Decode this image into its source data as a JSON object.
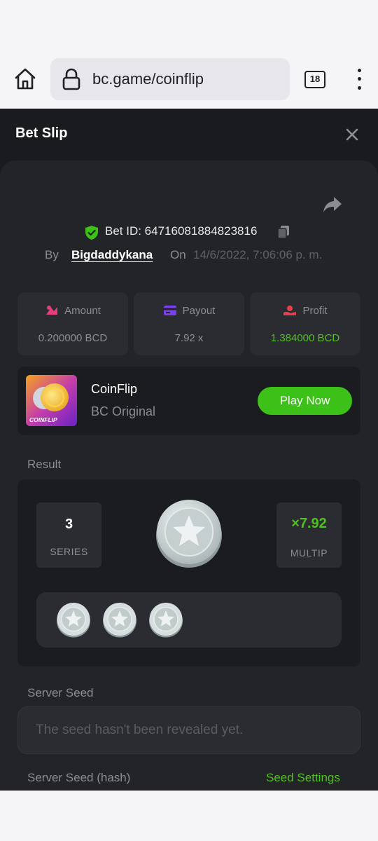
{
  "browser": {
    "url": "bc.game/coinflip",
    "tab_count": "18"
  },
  "header": {
    "title": "Bet Slip"
  },
  "bet": {
    "id_label": "Bet ID: 64716081884823816",
    "by_label": "By",
    "user": "Bigdaddykana",
    "on_label": "On",
    "date": "14/6/2022, 7:06:06 p. m."
  },
  "stats": [
    {
      "label": "Amount",
      "value": "0.200000 BCD",
      "icon": "amount-icon",
      "color": "#e73f7b"
    },
    {
      "label": "Payout",
      "value": "7.92 x",
      "icon": "card-icon",
      "color": "#7b3ff2"
    },
    {
      "label": "Profit",
      "value": "1.384000 BCD",
      "icon": "hand-coin-icon",
      "color": "#e73f4b"
    }
  ],
  "game": {
    "name": "CoinFlip",
    "subtitle": "BC Original",
    "thumb_text": "COINFLIP",
    "play_label": "Play Now"
  },
  "result": {
    "label": "Result",
    "series_value": "3",
    "series_label": "SERIES",
    "multiplier_value": "×7.92",
    "multiplier_label": "MULTIP"
  },
  "seed": {
    "server_label": "Server Seed",
    "placeholder": "The seed hasn't been revealed yet.",
    "hash_label": "Server Seed (hash)",
    "settings_link": "Seed Settings"
  },
  "colors": {
    "accent": "#3bc117",
    "bg": "#1a1b1e",
    "card": "#232428"
  }
}
